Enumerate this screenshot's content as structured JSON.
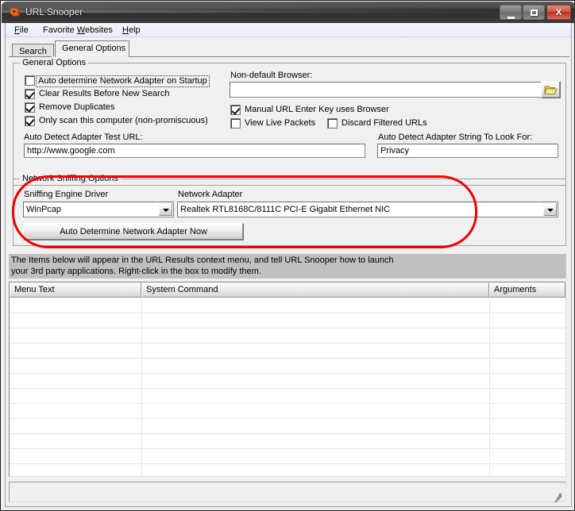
{
  "window": {
    "title": "URL Snooper",
    "icon": "fox-head-icon",
    "buttons": {
      "minimize": "minimize-button",
      "maximize": "maximize-button",
      "close_label": "X"
    }
  },
  "menubar": {
    "items": [
      {
        "label": "File",
        "accel": "F",
        "before": "",
        "after": "ile"
      },
      {
        "label": "Favorite Websites",
        "accel": "W",
        "before": "Favorite ",
        "after": "ebsites"
      },
      {
        "label": "Help",
        "accel": "H",
        "before": "",
        "after": "elp"
      }
    ]
  },
  "tabs": [
    {
      "label": "Search",
      "active": false
    },
    {
      "label": "General Options",
      "active": true
    }
  ],
  "general_options": {
    "group_title": "General Options",
    "checkboxes": [
      {
        "label": "Auto determine Network Adapter on Startup",
        "checked": false,
        "focused": true
      },
      {
        "label": "Clear Results Before New Search",
        "checked": true,
        "focused": false
      },
      {
        "label": "Remove Duplicates",
        "checked": true,
        "focused": false
      },
      {
        "label": "Only scan this computer (non-promiscuous)",
        "checked": true,
        "focused": false
      }
    ],
    "test_url": {
      "label": "Auto Detect Adapter Test URL:",
      "value": "http://www.google.com",
      "placeholder": ""
    },
    "non_default_browser": {
      "label": "Non-default Browser:",
      "value": "",
      "placeholder": "",
      "browse_icon": "open-folder-icon"
    },
    "browser_checkboxes": [
      {
        "label": "Manual URL Enter Key uses Browser",
        "checked": true
      },
      {
        "label": "View Live Packets",
        "checked": false
      },
      {
        "label": "Discard Filtered URLs",
        "checked": false
      }
    ],
    "detect_string": {
      "label": "Auto Detect Adapter String To Look For:",
      "value": "Privacy",
      "placeholder": ""
    }
  },
  "network_sniffing": {
    "group_title": "Network Sniffing Options",
    "highlight_color": "#ee0000",
    "driver": {
      "label": "Sniffing Engine Driver",
      "value": "WinPcap",
      "options": [
        "WinPcap"
      ]
    },
    "adapter": {
      "label": "Network Adapter",
      "value": "Realtek RTL8168C/8111C PCI-E Gigabit Ethernet NIC",
      "options": [
        "Realtek RTL8168C/8111C PCI-E Gigabit Ethernet NIC"
      ]
    },
    "auto_determine_button": "Auto Determine Network Adapter Now"
  },
  "info_panel": {
    "line1": "The Items below will appear in the URL Results context menu, and tell URL Snooper how to launch",
    "line2": "your 3rd party applications.  Right-click in the box to modify them."
  },
  "grid": {
    "columns": [
      "Menu Text",
      "System Command",
      "Arguments"
    ],
    "rows": []
  },
  "statusbar": {
    "text": ""
  }
}
